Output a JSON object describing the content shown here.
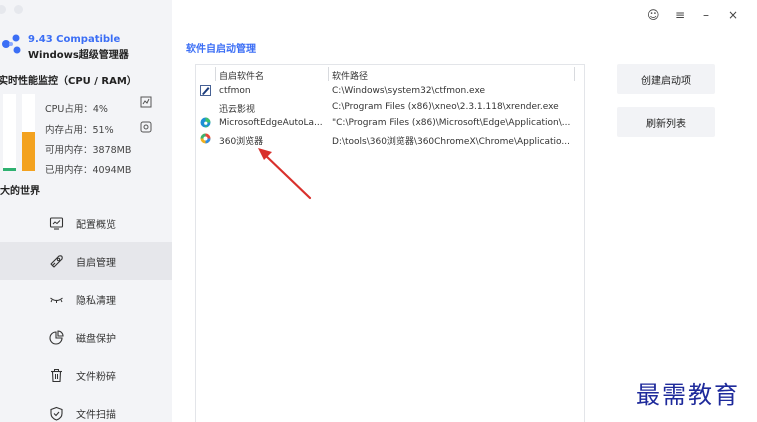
{
  "app": {
    "title_line1": "9.43 Compatible",
    "title_line2": "Windows超级管理器"
  },
  "monitor": {
    "title": "实时性能监控（CPU / RAM）",
    "cpu_label": "CPU占用：4%",
    "ram_label": "内存占用：51%",
    "available_label": "可用内存：3878MB",
    "used_label": "已用内存：4094MB",
    "cpu_percent": 4,
    "ram_percent": 51,
    "world": "强大的世界"
  },
  "nav": {
    "items": [
      {
        "label": "配置概览",
        "icon": "monitor-icon"
      },
      {
        "label": "自启管理",
        "icon": "rocket-icon"
      },
      {
        "label": "隐私清理",
        "icon": "eye-closed-icon"
      },
      {
        "label": "磁盘保护",
        "icon": "pie-chart-icon"
      },
      {
        "label": "文件粉碎",
        "icon": "trash-icon"
      },
      {
        "label": "文件扫描",
        "icon": "shield-icon"
      }
    ],
    "active_index": 1
  },
  "window_controls": {
    "feedback": "☺",
    "menu": "≡",
    "minimize": "–",
    "close": "×"
  },
  "main": {
    "section_title": "软件自启动管理",
    "columns": [
      "自启软件名",
      "软件路径"
    ],
    "rows": [
      {
        "name": "ctfmon",
        "path": "C:\\Windows\\system32\\ctfmon.exe",
        "icon": "pen-icon"
      },
      {
        "name": "迅云影视",
        "path": "C:\\Program Files (x86)\\xneo\\2.3.1.118\\xrender.exe",
        "icon": "blank-icon"
      },
      {
        "name": "MicrosoftEdgeAutoLa...",
        "path": "\"C:\\Program Files (x86)\\Microsoft\\Edge\\Application\\...",
        "icon": "edge-icon"
      },
      {
        "name": "360浏览器",
        "path": "D:\\tools\\360浏览器\\360ChromeX\\Chrome\\Applicatio...",
        "icon": "browser-360-icon"
      }
    ],
    "buttons": {
      "create": "创建启动项",
      "refresh": "刷新列表"
    }
  },
  "watermark": "最需教育",
  "colors": {
    "accent": "#3b6ef5",
    "arrow": "#d9302c",
    "cpu_bar": "#2fb170",
    "ram_bar": "#f3a21f"
  }
}
